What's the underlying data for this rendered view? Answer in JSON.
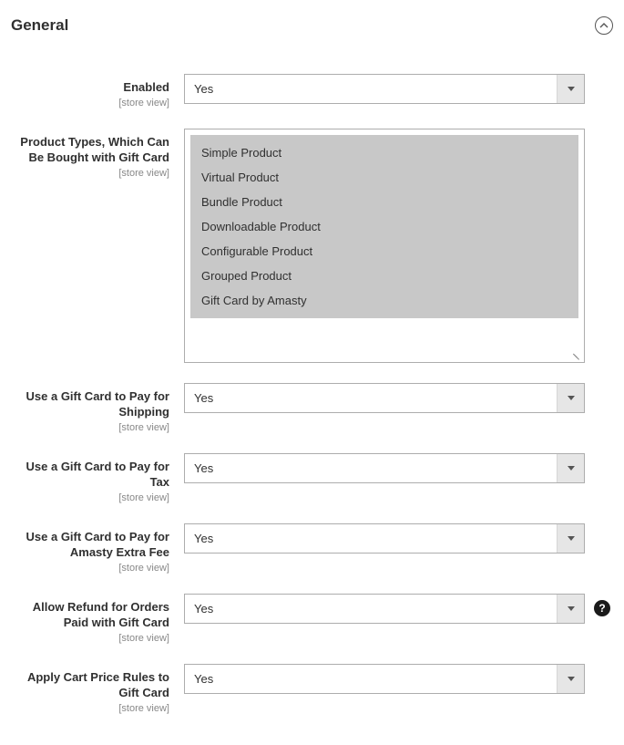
{
  "section": {
    "title": "General"
  },
  "scope_label": "[store view]",
  "fields": {
    "enabled": {
      "label": "Enabled",
      "value": "Yes"
    },
    "product_types": {
      "label": "Product Types, Which Can Be Bought with Gift Card",
      "options": [
        "Simple Product",
        "Virtual Product",
        "Bundle Product",
        "Downloadable Product",
        "Configurable Product",
        "Grouped Product",
        "Gift Card by Amasty"
      ]
    },
    "pay_shipping": {
      "label": "Use a Gift Card to Pay for Shipping",
      "value": "Yes"
    },
    "pay_tax": {
      "label": "Use a Gift Card to Pay for Tax",
      "value": "Yes"
    },
    "pay_extra_fee": {
      "label": "Use a Gift Card to Pay for Amasty Extra Fee",
      "value": "Yes"
    },
    "allow_refund": {
      "label": "Allow Refund for Orders Paid with Gift Card",
      "value": "Yes"
    },
    "apply_cart_rules": {
      "label": "Apply Cart Price Rules to Gift Card",
      "value": "Yes"
    }
  },
  "help_icon_text": "?"
}
